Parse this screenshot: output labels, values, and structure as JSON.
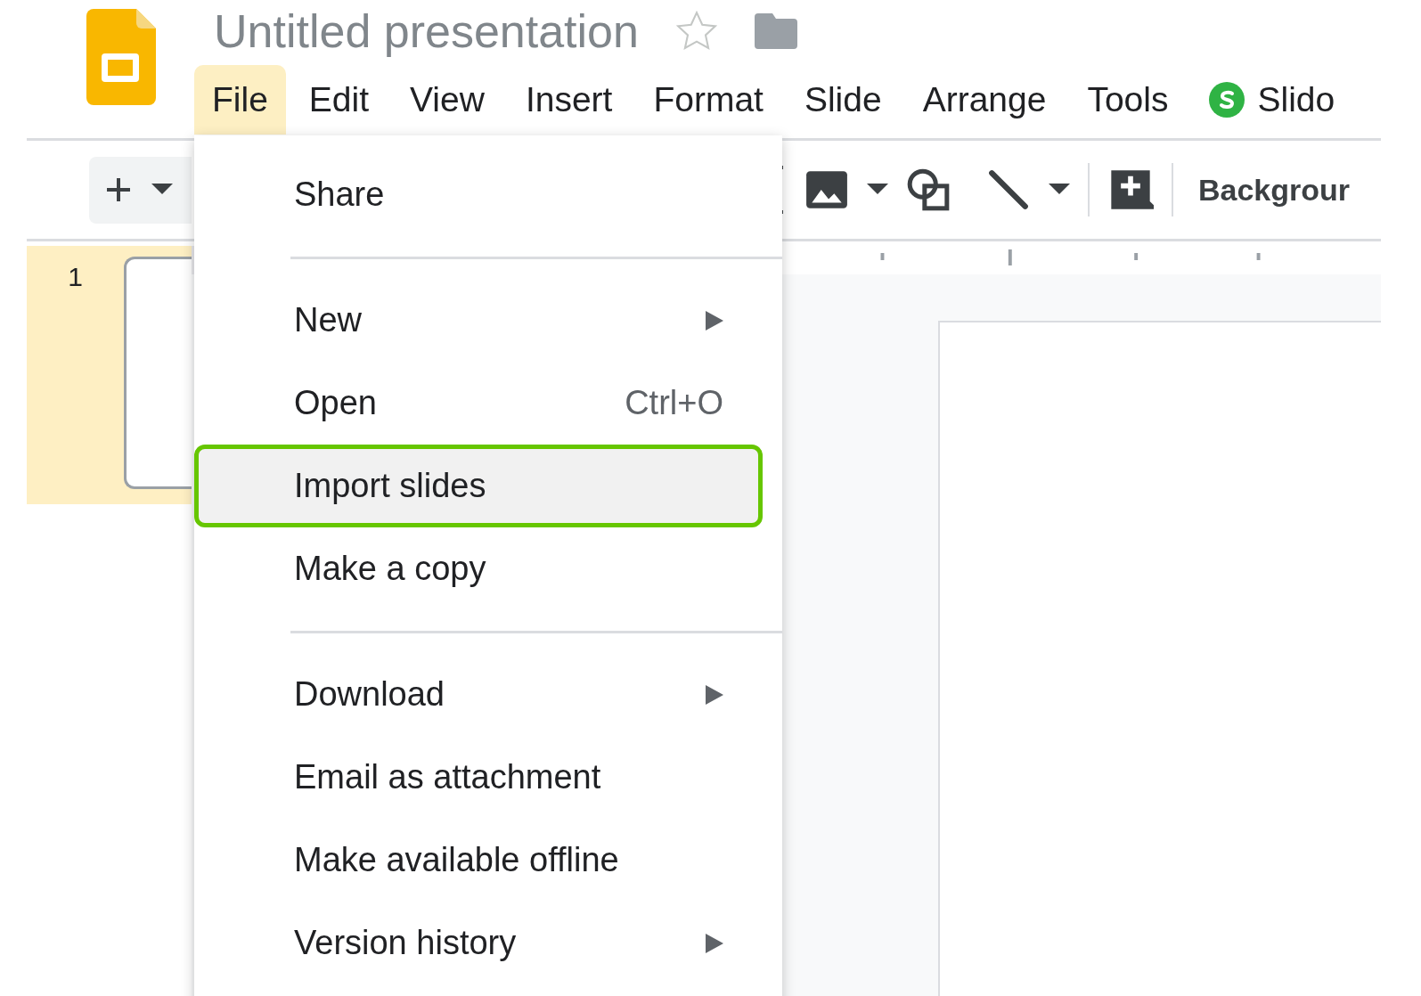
{
  "app_title": "Untitled presentation",
  "starred": false,
  "menu_bar": [
    {
      "label": "File",
      "kind": "menu",
      "selected": true
    },
    {
      "label": "Edit",
      "kind": "menu",
      "selected": false
    },
    {
      "label": "View",
      "kind": "menu",
      "selected": false
    },
    {
      "label": "Insert",
      "kind": "menu",
      "selected": false
    },
    {
      "label": "Format",
      "kind": "menu",
      "selected": false
    },
    {
      "label": "Slide",
      "kind": "menu",
      "selected": false
    },
    {
      "label": "Arrange",
      "kind": "menu",
      "selected": false
    },
    {
      "label": "Tools",
      "kind": "menu",
      "selected": false
    },
    {
      "label": "Slido",
      "kind": "addon",
      "selected": false
    }
  ],
  "toolbar": {
    "background_button": "Backgrour"
  },
  "slides": [
    {
      "number": "1",
      "selected": true
    }
  ],
  "file_menu": [
    {
      "kind": "item",
      "label": "Share",
      "submenu": false,
      "highlighted": false
    },
    {
      "kind": "separator"
    },
    {
      "kind": "item",
      "label": "New",
      "submenu": true,
      "highlighted": false
    },
    {
      "kind": "item",
      "label": "Open",
      "shortcut": "Ctrl+O",
      "submenu": false,
      "highlighted": false
    },
    {
      "kind": "item",
      "label": "Import slides",
      "submenu": false,
      "highlighted": true
    },
    {
      "kind": "item",
      "label": "Make a copy",
      "submenu": false,
      "highlighted": false
    },
    {
      "kind": "separator"
    },
    {
      "kind": "item",
      "label": "Download",
      "submenu": true,
      "highlighted": false
    },
    {
      "kind": "item",
      "label": "Email as attachment",
      "submenu": false,
      "highlighted": false
    },
    {
      "kind": "item",
      "label": "Make available offline",
      "submenu": false,
      "highlighted": false
    },
    {
      "kind": "item",
      "label": "Version history",
      "submenu": true,
      "highlighted": false
    }
  ]
}
